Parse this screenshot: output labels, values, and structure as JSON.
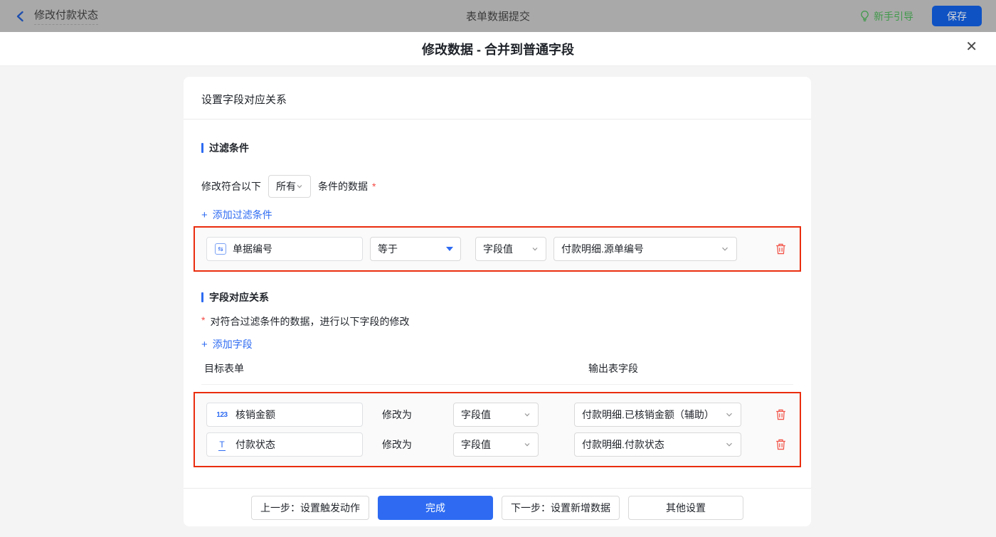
{
  "colors": {
    "accent_blue": "#2e6bf2",
    "guide_highlight_red": "#ea2d0f",
    "danger_red": "#f25449",
    "guide_green": "#41994b",
    "topbar_dimmed_bg": "#a9a9a9"
  },
  "topbar": {
    "title": "修改付款状态",
    "center_title": "表单数据提交",
    "guide_label": "新手引导",
    "save_label": "保存"
  },
  "modal": {
    "title": "修改数据 - 合并到普通字段",
    "close_glyph": "✕"
  },
  "card": {
    "header": "设置字段对应关系",
    "filter": {
      "title": "过滤条件",
      "prefix": "修改符合以下",
      "mode_value": "所有",
      "suffix": "条件的数据",
      "star": "*",
      "add_plus": "+",
      "add_label": "添加过滤条件",
      "condition": {
        "field_icon_glyph": "⇆",
        "field": "单据编号",
        "operator": "等于",
        "value_type": "字段值",
        "value": "付款明细.源单编号"
      }
    },
    "mapping": {
      "title": "字段对应关系",
      "star": "*",
      "desc": "对符合过滤条件的数据，进行以下字段的修改",
      "add_plus": "+",
      "add_label": "添加字段",
      "col_target": "目标表单",
      "col_output": "输出表字段",
      "rows": [
        {
          "icon_glyph": "123",
          "field": "核销金额",
          "modify_label": "修改为",
          "value_type": "字段值",
          "value": "付款明细.已核销金额（辅助）"
        },
        {
          "icon_glyph": "T",
          "field": "付款状态",
          "modify_label": "修改为",
          "value_type": "字段值",
          "value": "付款明细.付款状态"
        }
      ]
    },
    "footer": {
      "prev": "上一步：设置触发动作",
      "done": "完成",
      "next": "下一步：设置新增数据",
      "other": "其他设置"
    }
  }
}
